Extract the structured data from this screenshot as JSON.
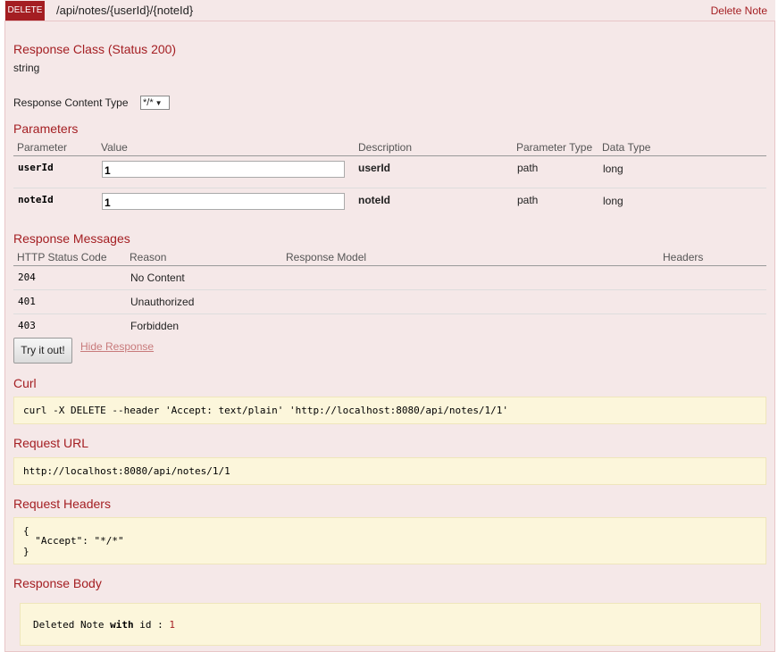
{
  "operation": {
    "method": "DELETE",
    "path": "/api/notes/{userId}/{noteId}",
    "summary": "Delete Note"
  },
  "response_class": {
    "title": "Response Class (Status 200)",
    "type": "string"
  },
  "content_type": {
    "label": "Response Content Type",
    "selected": "*/*"
  },
  "parameters": {
    "title": "Parameters",
    "headers": [
      "Parameter",
      "Value",
      "Description",
      "Parameter Type",
      "Data Type"
    ],
    "rows": [
      {
        "name": "userId",
        "value": "1",
        "description": "userId",
        "param_type": "path",
        "data_type": "long"
      },
      {
        "name": "noteId",
        "value": "1",
        "description": "noteId",
        "param_type": "path",
        "data_type": "long"
      }
    ]
  },
  "response_messages": {
    "title": "Response Messages",
    "headers": [
      "HTTP Status Code",
      "Reason",
      "Response Model",
      "Headers"
    ],
    "rows": [
      {
        "code": "204",
        "reason": "No Content"
      },
      {
        "code": "401",
        "reason": "Unauthorized"
      },
      {
        "code": "403",
        "reason": "Forbidden"
      }
    ]
  },
  "actions": {
    "try_label": "Try it out!",
    "hide_label": "Hide Response"
  },
  "curl": {
    "title": "Curl",
    "command": "curl -X DELETE --header 'Accept: text/plain' 'http://localhost:8080/api/notes/1/1'"
  },
  "request_url": {
    "title": "Request URL",
    "url": "http://localhost:8080/api/notes/1/1"
  },
  "request_headers": {
    "title": "Request Headers",
    "open_brace": "{",
    "line": "  \"Accept\": \"*/*\"",
    "close_brace": "}"
  },
  "response_body": {
    "title": "Response Body",
    "text_prefix": "Deleted Note ",
    "text_keyword": "with",
    "text_middle": " id : ",
    "text_value": "1"
  },
  "colors": {
    "accent": "#a41e22",
    "panel_bg": "#f5e8e8",
    "code_bg": "#fcf6db",
    "link_faded": "#c87a7b"
  }
}
